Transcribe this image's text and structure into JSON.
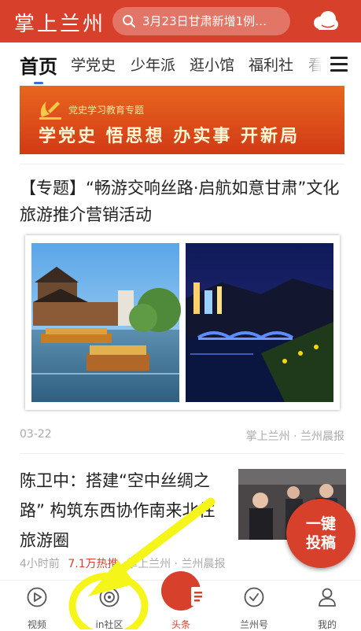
{
  "header": {
    "app_title": "掌上兰州",
    "search_text": "3月23日甘肃新增1例…",
    "weather_icon": "cloud-icon",
    "bg_color": "#d7402b"
  },
  "tabs": [
    "首页",
    "学党史",
    "少年派",
    "逛小馆",
    "福利社",
    "看"
  ],
  "banner": {
    "subtitle": "党史学习教育专题",
    "slogan": "学党史 悟思想 办实事 开新局"
  },
  "articles": [
    {
      "title": "【专题】“畅游交响丝路·启航如意甘肃”文化旅游推介营销活动",
      "date": "03-22",
      "source": "掌上兰州 · 兰州晨报"
    },
    {
      "title": "陈卫中：搭建“空中丝绸之路” 构筑东西协作南来北往旅游圈",
      "time": "4小时前",
      "hot": "7.1万热推",
      "source": "掌上兰州 · 兰州晨报"
    }
  ],
  "fab": {
    "line1": "一键",
    "line2": "投稿"
  },
  "bottom_nav": [
    {
      "label": "视频",
      "icon": "play-icon"
    },
    {
      "label": "in社区",
      "icon": "community-icon"
    },
    {
      "label": "头条",
      "icon": "news-icon"
    },
    {
      "label": "兰州号",
      "icon": "shield-check-icon"
    },
    {
      "label": "我的",
      "icon": "user-icon"
    }
  ],
  "accent_color": "#d7402b",
  "annotation_color": "#f5f51a"
}
